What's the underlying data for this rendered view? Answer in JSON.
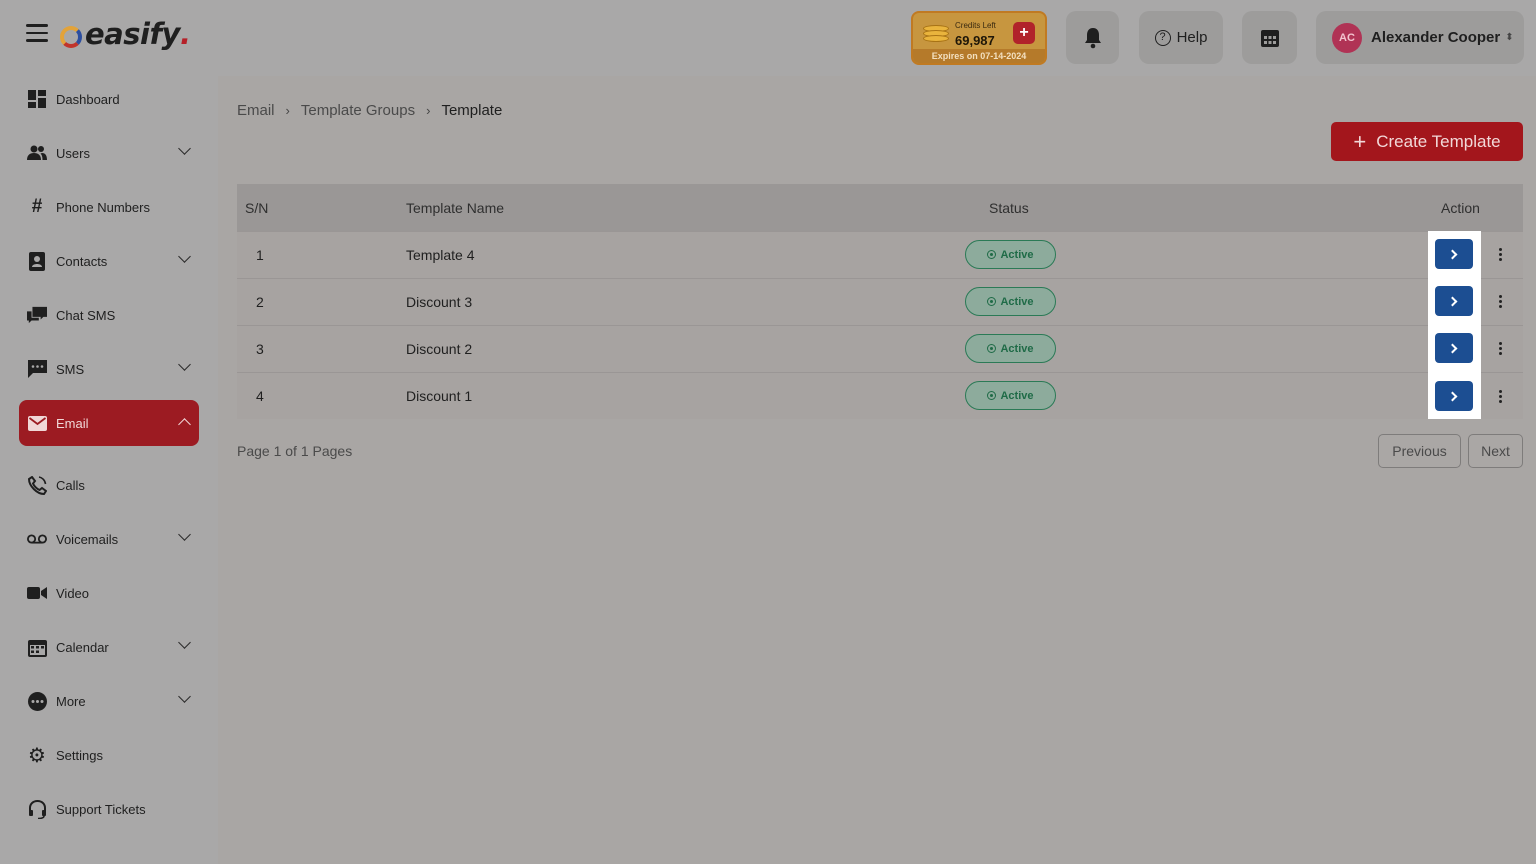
{
  "app": {
    "logo_text": "easify",
    "logo_dot": "."
  },
  "header": {
    "credits_label": "Credits Left",
    "credits_value": "69,987",
    "credits_add": "+",
    "credits_expiry": "Expires on 07-14-2024",
    "help_label": "Help",
    "user_initials": "AC",
    "user_name": "Alexander Cooper",
    "user_caret": "⌃⌄"
  },
  "sidebar": {
    "items": [
      {
        "label": "Dashboard",
        "icon": "dashboard-icon"
      },
      {
        "label": "Users",
        "icon": "users-icon"
      },
      {
        "label": "Phone Numbers",
        "icon": "hash-icon"
      },
      {
        "label": "Contacts",
        "icon": "contacts-icon"
      },
      {
        "label": "Chat SMS",
        "icon": "chat-icon"
      },
      {
        "label": "SMS",
        "icon": "sms-icon"
      },
      {
        "label": "Email",
        "icon": "mail-icon"
      },
      {
        "label": "Calls",
        "icon": "phone-icon"
      },
      {
        "label": "Voicemails",
        "icon": "voicemail-icon"
      },
      {
        "label": "Video",
        "icon": "video-icon"
      },
      {
        "label": "Calendar",
        "icon": "calendar-icon"
      },
      {
        "label": "More",
        "icon": "more-icon"
      },
      {
        "label": "Settings",
        "icon": "gear-icon"
      },
      {
        "label": "Support Tickets",
        "icon": "headset-icon"
      }
    ],
    "active": "Email"
  },
  "breadcrumb": [
    "Email",
    "Template Groups",
    "Template"
  ],
  "create_button": {
    "plus": "+",
    "label": "Create Template"
  },
  "table": {
    "headers": [
      "S/N",
      "Template Name",
      "Status",
      "Action"
    ],
    "rows": [
      {
        "sn": "1",
        "name": "Template 4",
        "status": "Active"
      },
      {
        "sn": "2",
        "name": "Discount 3",
        "status": "Active"
      },
      {
        "sn": "3",
        "name": "Discount 2",
        "status": "Active"
      },
      {
        "sn": "4",
        "name": "Discount 1",
        "status": "Active"
      }
    ]
  },
  "pagination": {
    "info": "Page 1 of 1 Pages",
    "previous": "Previous",
    "next": "Next"
  },
  "colors": {
    "accent_red": "#a3161c",
    "action_blue": "#1c4e92",
    "status_green": "#1f6b47"
  }
}
